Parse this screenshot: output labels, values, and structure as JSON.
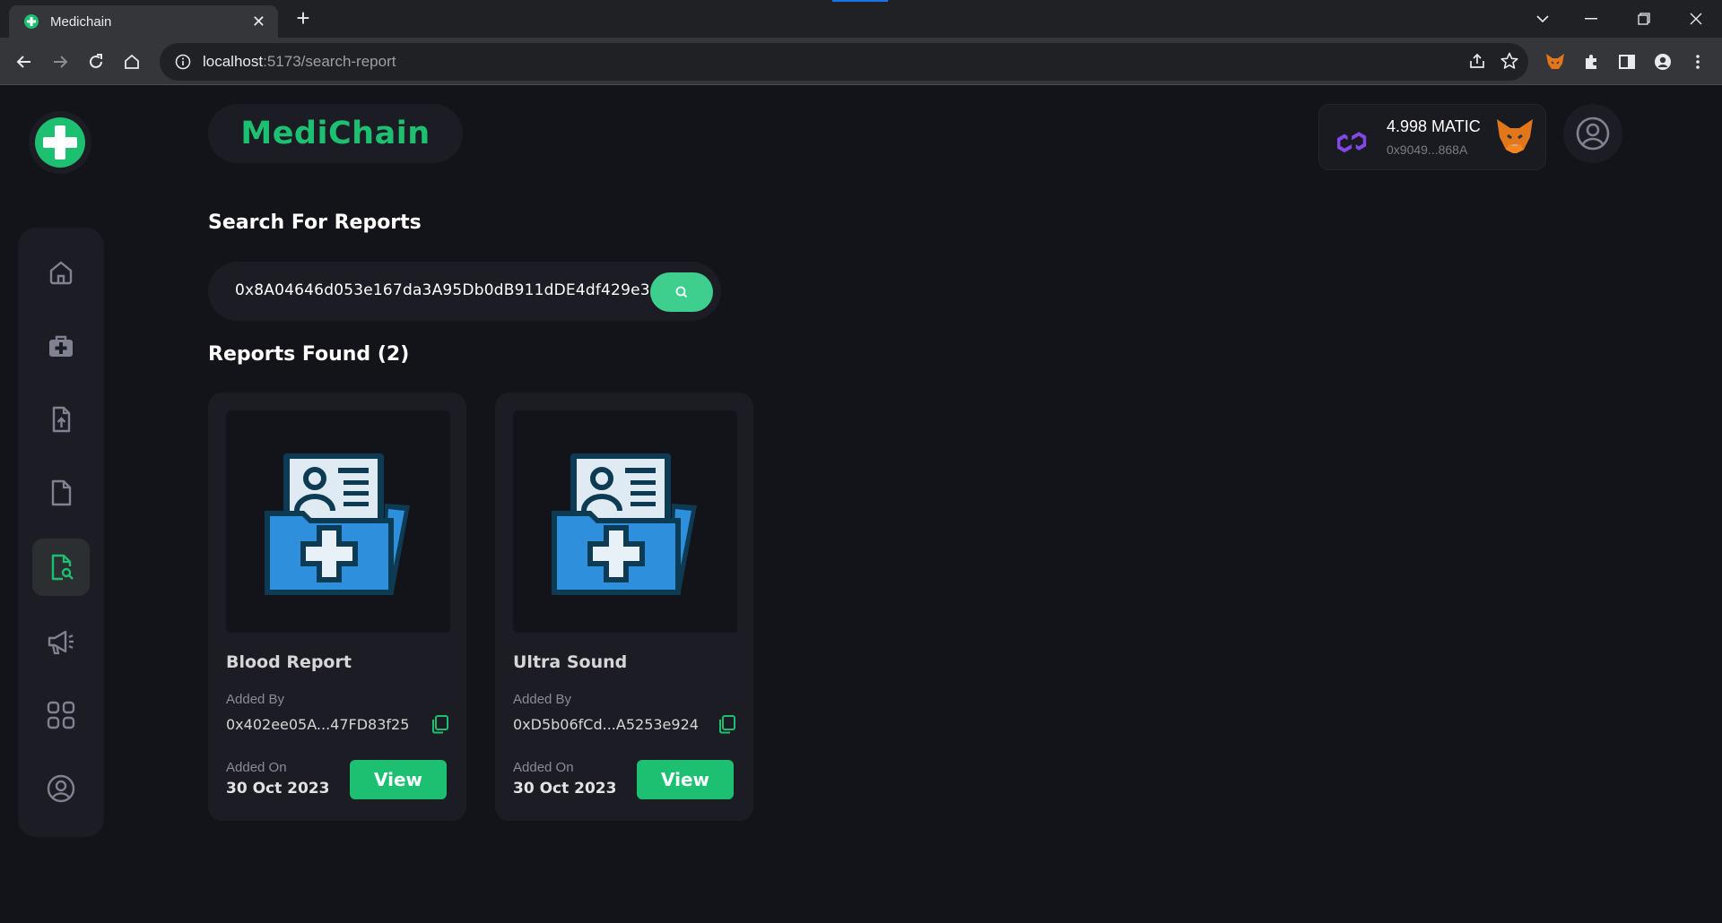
{
  "browser": {
    "tab_title": "Medichain",
    "url_host": "localhost",
    "url_path": ":5173/search-report"
  },
  "app": {
    "brand": "MediChain",
    "accent_color": "#1dc071",
    "sidebar_active": "search-reports",
    "sidebar_items": [
      "home",
      "medkit",
      "upload-report",
      "document",
      "search-reports",
      "campaign",
      "apps",
      "profile"
    ]
  },
  "wallet": {
    "balance": "4.998 MATIC",
    "address": "0x9049...868A"
  },
  "search": {
    "heading": "Search For Reports",
    "value": "0x8A04646d053e167da3A95Db0dB911dDE4df429e3"
  },
  "results": {
    "heading": "Reports Found (2)",
    "reports": [
      {
        "title": "Blood Report",
        "added_by_label": "Added By",
        "added_by": "0x402ee05A...47FD83f25",
        "added_on_label": "Added On",
        "added_on": "30 Oct 2023",
        "view_label": "View"
      },
      {
        "title": "Ultra Sound",
        "added_by_label": "Added By",
        "added_by": "0xD5b06fCd...A5253e924",
        "added_on_label": "Added On",
        "added_on": "30 Oct 2023",
        "view_label": "View"
      }
    ]
  }
}
